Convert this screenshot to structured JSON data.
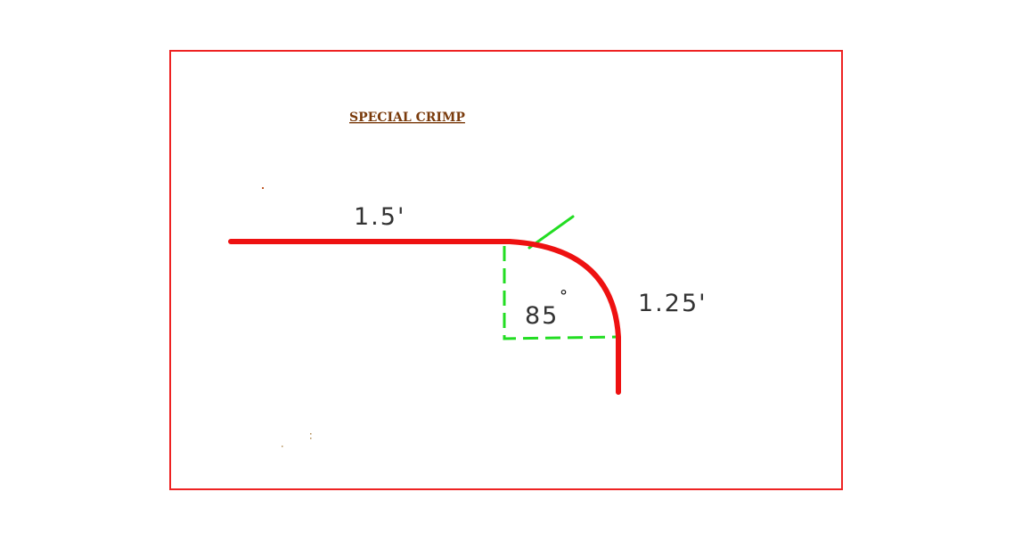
{
  "title": "SPECIAL CRIMP",
  "dimensions": {
    "top_length": "1.5'",
    "side_length": "1.25'",
    "angle": "85",
    "angle_unit": "°"
  },
  "colors": {
    "frame": "#ee2222",
    "profile": "#ee1111",
    "construction": "#22dd22",
    "title": "#7a3b0c",
    "dimension_text": "#333333",
    "background": "#ffffff"
  }
}
